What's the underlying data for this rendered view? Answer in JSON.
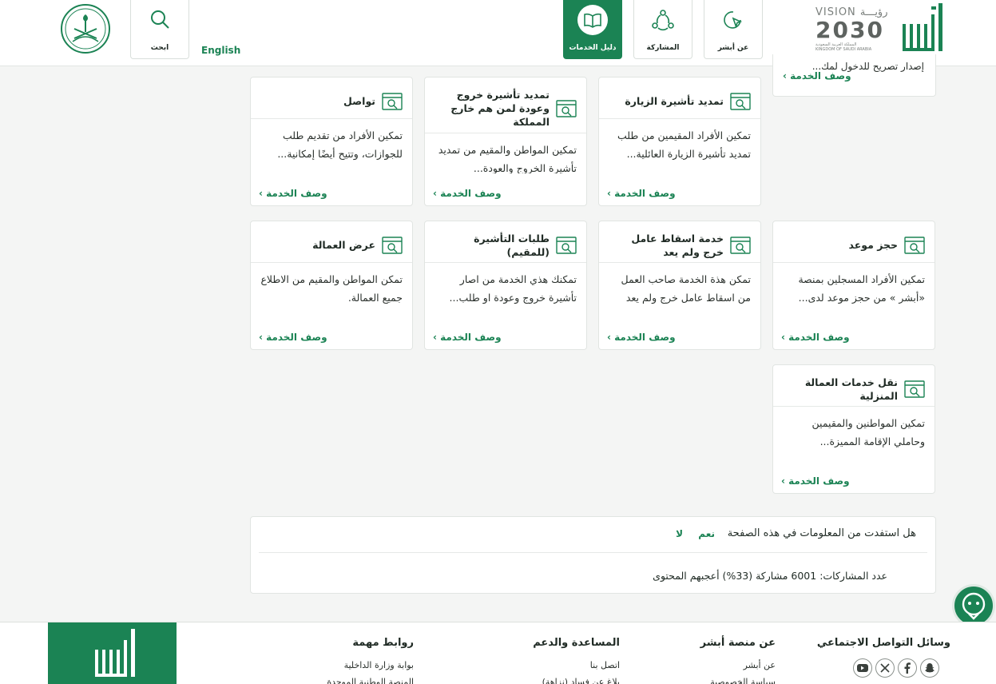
{
  "header": {
    "nav": [
      {
        "id": "about",
        "label": "عن أبشر",
        "icon": "cursor-click-icon"
      },
      {
        "id": "participation",
        "label": "المشاركة",
        "icon": "community-icon"
      },
      {
        "id": "services-guide",
        "label": "دليل الخدمات",
        "icon": "book-icon"
      }
    ],
    "search_label": "ابحث",
    "language_link": "English",
    "vision_line1": "VISION",
    "vision_arabic": "رؤيـــة",
    "vision_year": "2030",
    "vision_country_ar": "المملكة العربية السعودية",
    "vision_country_en": "KINGDOM OF SAUDI ARABIA"
  },
  "partial_card": {
    "desc_cut": "إصدار تصريح للدخول لمك...",
    "more_label": "وصف الخدمة ›"
  },
  "cards": [
    {
      "title": "تمديد تأشيرة الزيارة",
      "desc": "تمكين الأفراد المقيمين من طلب تمديد تأشيرة الزيارة العائلية...",
      "more": "وصف الخدمة ›"
    },
    {
      "title": "تمديد تأشيرة خروج وعودة لمن هم خارج المملكة",
      "desc": "تمكين المواطن والمقيم من تمديد تأشيرة الخروج والعودة...",
      "more": "وصف الخدمة ›"
    },
    {
      "title": "تواصل",
      "desc": "تمكين الأفراد من تقديم طلب للجوازات، وتتيح أيضًا إمكانية...",
      "more": "وصف الخدمة ›"
    },
    {
      "title": "حجز موعد",
      "desc": "تمكين الأفراد المسجلين بمنصة «أبشر » من حجز موعد لدى...",
      "more": "وصف الخدمة ›"
    },
    {
      "title": "خدمة اسقاط عامل خرج ولم يعد",
      "desc": "تمكن هذة الخدمة صاحب العمل من اسقاط عامل خرج ولم يعد",
      "more": "وصف الخدمة ›"
    },
    {
      "title": "طلبات التأشيرة (للمقيم)",
      "desc": "تمكنك هذي الخدمة من اصار تأشيرة خروج وعودة او طلب...",
      "more": "وصف الخدمة ›"
    },
    {
      "title": "عرض العمالة",
      "desc": "تمكن المواطن والمقيم من الاطلاع جميع العمالة.",
      "more": "وصف الخدمة ›"
    },
    {
      "title": "نقل خدمات العمالة المنزلية",
      "desc": "تمكين المواطنين والمقيمين وحاملي الإقامة المميزة...",
      "more": "وصف الخدمة ›"
    }
  ],
  "feedback": {
    "question": "هل استفدت من المعلومات في هذه الصفحة",
    "yes": "نعم",
    "no": "لا",
    "stats": "عدد المشاركات: 6001 مشاركة (33%) أعجبهم المحتوى"
  },
  "footer": {
    "social_title": "وسائل التواصل الاجتماعي",
    "social_icons": [
      "youtube-icon",
      "x-icon",
      "facebook-icon",
      "snapchat-icon"
    ],
    "about_title": "عن منصة أبشر",
    "about_links": [
      "عن أبشر",
      "سياسة الخصوصية"
    ],
    "support_title": "المساعدة والدعم",
    "support_links": [
      "اتصل بنا",
      "بلاغ عن فساد (نزاهة)"
    ],
    "links_title": "روابط مهمة",
    "important_links": [
      "بوابة وزارة الداخلية",
      "المنصة الوطنية الموحدة"
    ]
  },
  "colors": {
    "brand": "#1b8354",
    "text": "#1f2a24",
    "border": "#e1e5e2"
  }
}
